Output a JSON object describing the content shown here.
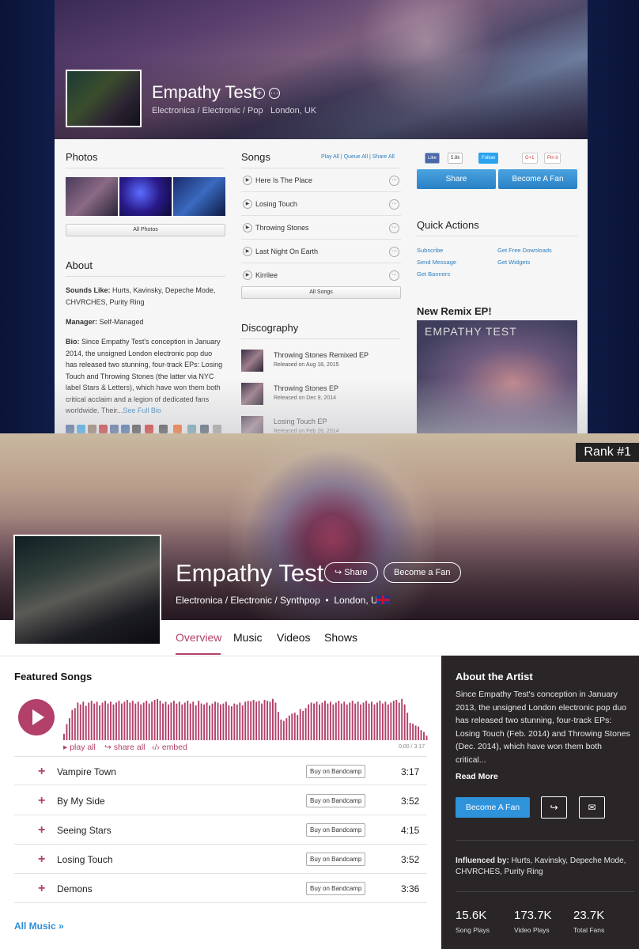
{
  "top": {
    "artist_name": "Empathy Test",
    "genres": "Electronica / Electronic / Pop",
    "location": "London, UK",
    "photos_title": "Photos",
    "all_photos": "All Photos",
    "about_title": "About",
    "sounds_like_label": "Sounds Like:",
    "sounds_like": "Hurts, Kavinsky, Depeche Mode, CHVRCHES, Purity Ring",
    "manager_label": "Manager:",
    "manager": "Self-Managed",
    "bio_label": "Bio:",
    "bio": "Since Empathy Test's conception in January 2014, the unsigned London electronic pop duo has released two stunning, four-track EPs: Losing Touch and Throwing Stones (the latter via NYC label Stars & Letters), which have won them both critical acclaim and a legion of dedicated fans worldwide. Their...",
    "see_full_bio": "See Full Bio",
    "songs_title": "Songs",
    "songs_links": [
      "Play All",
      "Queue All",
      "Share All"
    ],
    "songs": [
      "Here Is The Place",
      "Losing Touch",
      "Throwing Stones",
      "Last Night On Earth",
      "Kirrilee"
    ],
    "all_songs": "All Songs",
    "discography_title": "Discography",
    "discography": [
      {
        "title": "Throwing Stones Remixed EP",
        "released": "Released on Aug 18, 2015"
      },
      {
        "title": "Throwing Stones EP",
        "released": "Released on Dec 9, 2014"
      },
      {
        "title": "Losing Touch EP",
        "released": "Released on Feb 28, 2014"
      }
    ],
    "fb_like": "Like",
    "fb_count": "5.8k",
    "tw_follow": "Follow",
    "gplus": "G+1",
    "pinit": "Pin it",
    "share_btn": "Share",
    "become_fan_btn": "Become A Fan",
    "quick_actions_title": "Quick Actions",
    "quick_actions": [
      "Subscribe",
      "Get Free Downloads",
      "Send Message",
      "Get Widgets",
      "Get Banners"
    ],
    "remix_title": "New Remix EP!",
    "remix_art_text": "EMPATHY TEST"
  },
  "main": {
    "rank": "Rank #1",
    "artist_name": "Empathy Test",
    "share": "Share",
    "become_fan": "Become a Fan",
    "genres": "Electronica / Electronic / Synthpop",
    "location": "London, UK",
    "tabs": [
      "Overview",
      "Music",
      "Videos",
      "Shows"
    ],
    "featured_title": "Featured Songs",
    "play_all": "play all",
    "share_all": "share all",
    "embed": "embed",
    "time": "0:00 / 3:17",
    "waveform": [
      0.14,
      0.35,
      0.48,
      0.66,
      0.7,
      0.82,
      0.78,
      0.84,
      0.75,
      0.82,
      0.86,
      0.8,
      0.84,
      0.76,
      0.82,
      0.86,
      0.8,
      0.84,
      0.78,
      0.82,
      0.86,
      0.8,
      0.84,
      0.88,
      0.82,
      0.86,
      0.8,
      0.84,
      0.78,
      0.82,
      0.86,
      0.8,
      0.84,
      0.88,
      0.9,
      0.86,
      0.8,
      0.84,
      0.78,
      0.82,
      0.86,
      0.8,
      0.84,
      0.78,
      0.82,
      0.86,
      0.8,
      0.84,
      0.76,
      0.86,
      0.8,
      0.78,
      0.82,
      0.76,
      0.8,
      0.84,
      0.82,
      0.78,
      0.8,
      0.84,
      0.76,
      0.74,
      0.8,
      0.78,
      0.82,
      0.76,
      0.84,
      0.86,
      0.85,
      0.88,
      0.84,
      0.86,
      0.8,
      0.88,
      0.86,
      0.84,
      0.9,
      0.82,
      0.62,
      0.45,
      0.42,
      0.48,
      0.54,
      0.58,
      0.6,
      0.55,
      0.68,
      0.64,
      0.7,
      0.78,
      0.82,
      0.8,
      0.84,
      0.78,
      0.82,
      0.86,
      0.8,
      0.84,
      0.78,
      0.82,
      0.86,
      0.8,
      0.84,
      0.78,
      0.82,
      0.86,
      0.8,
      0.84,
      0.78,
      0.82,
      0.86,
      0.8,
      0.84,
      0.78,
      0.82,
      0.86,
      0.8,
      0.84,
      0.78,
      0.82,
      0.86,
      0.88,
      0.82,
      0.9,
      0.78,
      0.6,
      0.38,
      0.36,
      0.32,
      0.3,
      0.22,
      0.18,
      0.1
    ],
    "tracks": [
      {
        "name": "Vampire Town",
        "bandcamp": "Buy on Bandcamp",
        "duration": "3:17"
      },
      {
        "name": "By My Side",
        "bandcamp": "Buy on Bandcamp",
        "duration": "3:52"
      },
      {
        "name": "Seeing Stars",
        "bandcamp": "Buy on Bandcamp",
        "duration": "4:15"
      },
      {
        "name": "Losing Touch",
        "bandcamp": "Buy on Bandcamp",
        "duration": "3:52"
      },
      {
        "name": "Demons",
        "bandcamp": "Buy on Bandcamp",
        "duration": "3:36"
      }
    ],
    "all_music": "All Music »",
    "about_title": "About the Artist",
    "about_text": "Since Empathy Test's conception in January 2013, the unsigned London electronic pop duo has released two stunning, four-track EPs: Losing Touch (Feb. 2014) and Throwing Stones (Dec. 2014), which have won them both critical...",
    "read_more": "Read More",
    "fan_button": "Become A Fan",
    "influenced_label": "Influenced by:",
    "influenced": "Hurts, Kavinsky, Depeche Mode, CHVRCHES, Purity Ring",
    "stats": [
      {
        "value": "15.6K",
        "label": "Song Plays"
      },
      {
        "value": "173.7K",
        "label": "Video Plays"
      },
      {
        "value": "23.7K",
        "label": "Total Fans"
      }
    ]
  },
  "colors": {
    "accent": "#b2406b",
    "link": "#2d8fd5",
    "panel": "#2a2627"
  }
}
